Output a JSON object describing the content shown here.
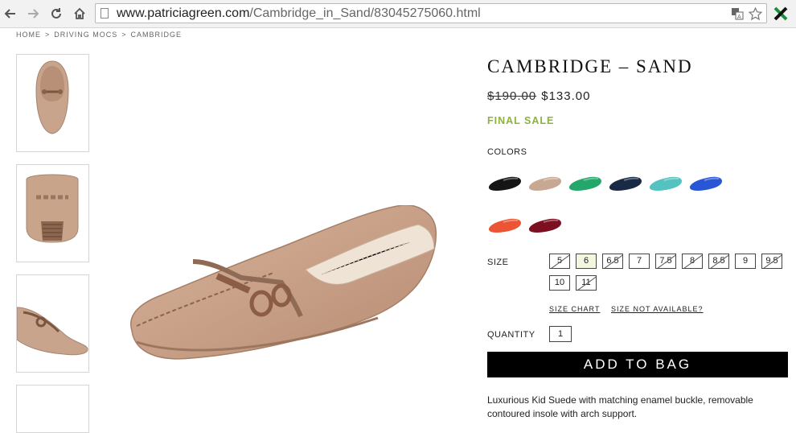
{
  "browser": {
    "url_domain": "www.patriciagreen.com",
    "url_path": "/Cambridge_in_Sand/83045275060.html",
    "back_icon": "arrow-left-icon",
    "forward_icon": "arrow-right-icon",
    "reload_icon": "reload-icon",
    "home_icon": "home-icon",
    "translate_icon": "translate-icon",
    "bookmark_icon": "star-icon",
    "extension_icon": "extension-x-icon"
  },
  "breadcrumb": [
    "HOME",
    ">",
    "DRIVING MOCS",
    ">",
    "CAMBRIDGE"
  ],
  "product": {
    "title": "CAMBRIDGE – SAND",
    "old_price": "$190.00",
    "price": "$133.00",
    "final_sale": "FINAL SALE",
    "final_sale_color": "#8cb33c",
    "colors_label": "COLORS",
    "swatches": [
      {
        "name": "black",
        "color": "#151515"
      },
      {
        "name": "sand",
        "color": "#c9a893"
      },
      {
        "name": "green",
        "color": "#23a76b"
      },
      {
        "name": "navy",
        "color": "#1b2a44"
      },
      {
        "name": "aqua",
        "color": "#53c2c0"
      },
      {
        "name": "blue",
        "color": "#2856d6"
      },
      {
        "name": "coral",
        "color": "#ec5433"
      },
      {
        "name": "burgundy",
        "color": "#7d1020"
      }
    ],
    "size_label": "SIZE",
    "sizes": [
      {
        "label": "5",
        "available": false,
        "selected": false
      },
      {
        "label": "6",
        "available": true,
        "selected": true
      },
      {
        "label": "6.5",
        "available": false,
        "selected": false
      },
      {
        "label": "7",
        "available": true,
        "selected": false
      },
      {
        "label": "7.5",
        "available": false,
        "selected": false
      },
      {
        "label": "8",
        "available": false,
        "selected": false
      },
      {
        "label": "8.5",
        "available": false,
        "selected": false
      },
      {
        "label": "9",
        "available": true,
        "selected": false
      },
      {
        "label": "9.5",
        "available": false,
        "selected": false
      },
      {
        "label": "10",
        "available": true,
        "selected": false
      },
      {
        "label": "11",
        "available": false,
        "selected": false
      }
    ],
    "size_chart": "SIZE CHART",
    "size_not_available": "SIZE NOT AVAILABLE?",
    "quantity_label": "QUANTITY",
    "quantity": "1",
    "add_to_bag": "ADD TO BAG",
    "description": "Luxurious Kid Suede with matching enamel buckle, removable contoured insole with arch support."
  }
}
